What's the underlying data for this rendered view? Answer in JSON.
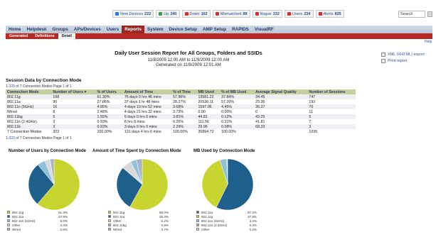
{
  "status_bar": [
    {
      "label": "New Devices",
      "count": "222",
      "color": "#2a7bd4"
    },
    {
      "label": "Up",
      "count": "340",
      "color": "#2ea043"
    },
    {
      "label": "Down",
      "count": "162",
      "color": "#d03030"
    },
    {
      "label": "Mismatched",
      "count": "88",
      "color": "#d03030"
    },
    {
      "label": "Rogue",
      "count": "332",
      "color": "#d03030"
    },
    {
      "label": "Users",
      "count": "234",
      "color": "#d03030"
    },
    {
      "label": "Alerts",
      "count": "825",
      "color": "#d03030"
    }
  ],
  "search": {
    "value": "Search"
  },
  "nav": {
    "tabs": [
      "Home",
      "Helpdesk",
      "Groups",
      "APs/Devices",
      "Users",
      "Reports",
      "System",
      "Device Setup",
      "AMP Setup",
      "RAPIDS",
      "VisualRF"
    ],
    "active_tab": "Reports",
    "subtabs": [
      "Generated",
      "Definitions",
      "Detail"
    ],
    "active_subtab": "Detail",
    "help": "Help"
  },
  "report": {
    "title": "Daily User Session Report for All Groups, Folders and SSIDs",
    "range": "11/8/2009 12:00 AM to 11/9/2009 12:00 AM",
    "generated": "Generated on 11/9/2009 12:01 AM",
    "exports": [
      "XML (XHTML) export",
      "Print report"
    ]
  },
  "section_title": "Session Data by Connection Mode",
  "pager": {
    "prefix": "1-",
    "middle": " of 7 Connection Modes  Page ",
    "page": "1",
    "suffix": " of 1"
  },
  "table": {
    "headers": [
      "Connection Mode",
      "Number of Users ▾",
      "% of Users",
      "Amount of Time",
      "% of Time",
      "MB Used",
      "% of MB Used",
      "Average Signal Quality",
      "Number of Sessions"
    ],
    "rows": [
      [
        "802.11g",
        "198",
        "61.30%",
        "76 days 0 hrs 46 mins",
        "57.96%",
        "13581.22",
        "37.84%",
        "34.45",
        "747"
      ],
      [
        "802.11a",
        "90",
        "27.86%",
        "37 days 1 hr 48 mins",
        "28.27%",
        "20530.11",
        "57.20%",
        "25.36",
        "192"
      ],
      [
        "802.11n (5GHz)",
        "16",
        "4.95%",
        "4 days 19 hrs 52 mins",
        "3.68%",
        "1597.06",
        "4.45%",
        "35.37",
        "70"
      ],
      [
        "Wired",
        "8",
        "2.48%",
        "4 days 21 hrs 32 mins",
        "3.73%",
        "0.00",
        "0.00%",
        "0",
        "11"
      ],
      [
        "802.11bg",
        "5",
        "1.55%",
        "5 days 0 hrs 0 mins",
        "3.81%",
        "44.81",
        "0.12%",
        "43.25",
        "5"
      ],
      [
        "802.11n (2.4GHz)",
        "3",
        "0.93%",
        "8 hrs 8 mins",
        "0.26%",
        "111.56",
        "0.31%",
        "41.81",
        "7"
      ],
      [
        "802.11b",
        "3",
        "0.93%",
        "3 days 0 hrs 0 mins",
        "2.29%",
        "29.96",
        "0.08%",
        "68.33",
        "3"
      ],
      [
        "7 Connection Modes",
        "323",
        "100.00%",
        "131 days 4 hrs 6 mins",
        "100.00%",
        "35894.72",
        "100.00%",
        "",
        "1035"
      ]
    ]
  },
  "charts": [
    {
      "title": "Number of Users by Connection Mode",
      "legend": [
        {
          "name": "802.11g",
          "pct": "61.3%",
          "value": 61.3,
          "color": "#c8d530"
        },
        {
          "name": "802.11a",
          "pct": "27.9%",
          "value": 27.9,
          "color": "#1f5f8b"
        },
        {
          "name": "802.11n (5GHz)",
          "pct": "5.0%",
          "value": 5.0,
          "color": "#8fc1d8"
        },
        {
          "name": "Other",
          "pct": "3.4%",
          "value": 3.4,
          "color": "#d9d9d9"
        },
        {
          "name": "Wired",
          "pct": "2.5%",
          "value": 2.5,
          "color": "#aab4be"
        }
      ]
    },
    {
      "title": "Amount of Time Spent by Connection Mode",
      "legend": [
        {
          "name": "802.11g",
          "pct": "58.0%",
          "value": 58.0,
          "color": "#c8d530"
        },
        {
          "name": "802.11a",
          "pct": "28.3%",
          "value": 28.3,
          "color": "#1f5f8b"
        },
        {
          "name": "Other",
          "pct": "6.2%",
          "value": 6.2,
          "color": "#d9d9d9"
        },
        {
          "name": "802.11bg",
          "pct": "3.8%",
          "value": 3.8,
          "color": "#8fc1d8"
        },
        {
          "name": "Wired",
          "pct": "3.7%",
          "value": 3.7,
          "color": "#aab4be"
        }
      ]
    },
    {
      "title": "MB Used by Connection Mode",
      "legend": [
        {
          "name": "802.11a",
          "pct": "57.2%",
          "value": 57.2,
          "color": "#1f5f8b"
        },
        {
          "name": "802.11g",
          "pct": "37.8%",
          "value": 37.8,
          "color": "#c8d530"
        },
        {
          "name": "802.11n (5GHz)",
          "pct": "4.4%",
          "value": 4.4,
          "color": "#8fc1d8"
        },
        {
          "name": "802.11n (2.4GHz)",
          "pct": "0.3%",
          "value": 0.3,
          "color": "#aab4be"
        },
        {
          "name": "Other",
          "pct": "0.2%",
          "value": 0.2,
          "color": "#d9d9d9"
        }
      ]
    }
  ]
}
